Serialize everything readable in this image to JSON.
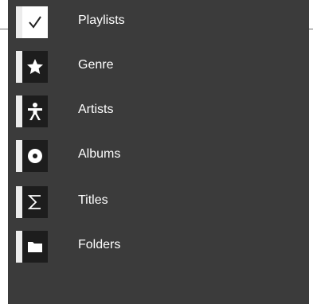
{
  "menu": {
    "items": [
      {
        "label": "Playlists",
        "icon": "checkmark-icon",
        "selected": true
      },
      {
        "label": "Genre",
        "icon": "star-icon",
        "selected": false
      },
      {
        "label": "Artists",
        "icon": "person-icon",
        "selected": false
      },
      {
        "label": "Albums",
        "icon": "disc-icon",
        "selected": false
      },
      {
        "label": "Titles",
        "icon": "sigma-icon",
        "selected": false
      },
      {
        "label": "Folders",
        "icon": "folder-icon",
        "selected": false
      }
    ]
  },
  "colors": {
    "panel_background": "#3b3b3b",
    "icon_box": "#1d1d1d",
    "icon_strip": "#ececec",
    "text": "#ffffff"
  }
}
